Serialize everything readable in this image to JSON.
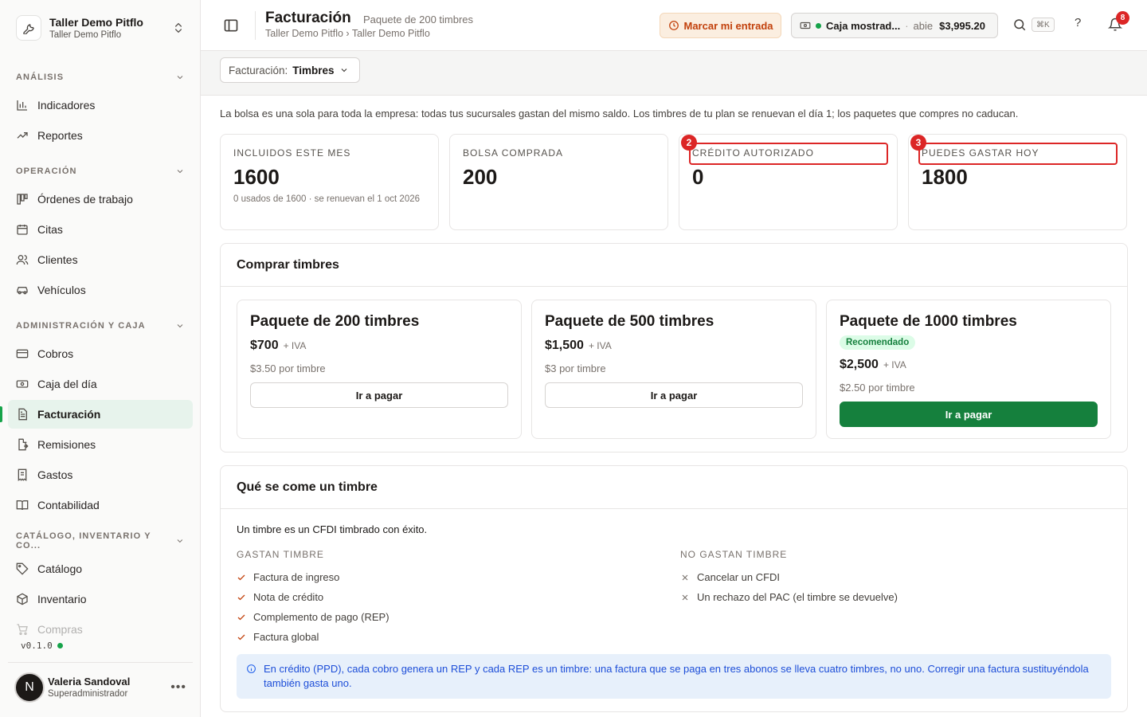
{
  "org": {
    "name": "Taller Demo Pitflo",
    "subtitle": "Taller Demo Pitflo"
  },
  "sidebar": {
    "sections": [
      {
        "title": "ANÁLISIS",
        "items": [
          {
            "label": "Indicadores",
            "icon": "bar-chart-icon"
          },
          {
            "label": "Reportes",
            "icon": "trending-up-icon"
          }
        ]
      },
      {
        "title": "OPERACIÓN",
        "items": [
          {
            "label": "Órdenes de trabajo",
            "icon": "kanban-icon"
          },
          {
            "label": "Citas",
            "icon": "calendar-icon"
          },
          {
            "label": "Clientes",
            "icon": "users-icon"
          },
          {
            "label": "Vehículos",
            "icon": "car-icon"
          }
        ]
      },
      {
        "title": "ADMINISTRACIÓN Y CAJA",
        "items": [
          {
            "label": "Cobros",
            "icon": "credit-card-icon"
          },
          {
            "label": "Caja del día",
            "icon": "banknote-icon"
          },
          {
            "label": "Facturación",
            "icon": "file-text-icon"
          },
          {
            "label": "Remisiones",
            "icon": "file-export-icon"
          },
          {
            "label": "Gastos",
            "icon": "receipt-icon"
          },
          {
            "label": "Contabilidad",
            "icon": "book-open-icon"
          }
        ]
      },
      {
        "title": "CATÁLOGO, INVENTARIO Y CO...",
        "items": [
          {
            "label": "Catálogo",
            "icon": "tag-icon"
          },
          {
            "label": "Inventario",
            "icon": "package-icon"
          },
          {
            "label": "Compras",
            "icon": "cart-icon"
          }
        ]
      }
    ],
    "active_item": "Facturación",
    "version": "v0.1.0"
  },
  "user": {
    "initial": "N",
    "name": "Valeria Sandoval",
    "role": "Superadministrador"
  },
  "header": {
    "title": "Facturación",
    "subtitle": "Paquete de 200 timbres",
    "breadcrumb": "Taller Demo Pitflo › Taller Demo Pitflo",
    "entrada_button": "Marcar mi entrada",
    "caja": {
      "name": "Caja mostrad...",
      "separator": "·",
      "status": "abie",
      "amount": "$3,995.20"
    },
    "search_shortcut": "⌘K",
    "help": "?",
    "notifications_count": "8"
  },
  "subbar": {
    "select_label": "Facturación:",
    "select_value": "Timbres"
  },
  "intro": "La bolsa es una sola para toda la empresa: todas tus sucursales gastan del mismo saldo. Los timbres de tu plan se renuevan el día 1; los paquetes que compres no caducan.",
  "stats": [
    {
      "label": "INCLUIDOS ESTE MES",
      "value": "1600",
      "note": "0 usados de 1600 · se renuevan el 1 oct 2026"
    },
    {
      "label": "BOLSA COMPRADA",
      "value": "200"
    },
    {
      "label": "CRÉDITO AUTORIZADO",
      "value": "0",
      "marker": "2"
    },
    {
      "label": "PUEDES GASTAR HOY",
      "value": "1800",
      "marker": "3"
    }
  ],
  "buy": {
    "title": "Comprar timbres",
    "packages": [
      {
        "title": "Paquete de 200 timbres",
        "price": "$700",
        "tax": "+ IVA",
        "per": "$3.50 por timbre",
        "button": "Ir a pagar"
      },
      {
        "title": "Paquete de 500 timbres",
        "price": "$1,500",
        "tax": "+ IVA",
        "per": "$3 por timbre",
        "button": "Ir a pagar"
      },
      {
        "title": "Paquete de 1000 timbres",
        "badge": "Recomendado",
        "price": "$2,500",
        "tax": "+ IVA",
        "per": "$2.50 por timbre",
        "button": "Ir a pagar"
      }
    ]
  },
  "info": {
    "title": "Qué se come un timbre",
    "definition": "Un timbre es un CFDI timbrado con éxito.",
    "spend_title": "GASTAN TIMBRE",
    "spend": [
      "Factura de ingreso",
      "Nota de crédito",
      "Complemento de pago (REP)",
      "Factura global"
    ],
    "nospend_title": "NO GASTAN TIMBRE",
    "nospend": [
      "Cancelar un CFDI",
      "Un rechazo del PAC (el timbre se devuelve)"
    ],
    "note": "En crédito (PPD), cada cobro genera un REP y cada REP es un timbre: una factura que se paga en tres abonos se lleva cuatro timbres, no uno. Corregir una factura sustituyéndola también gasta uno."
  },
  "colors": {
    "accent": "#15803d",
    "highlight": "#dc2626",
    "warning": "#c2410c"
  }
}
